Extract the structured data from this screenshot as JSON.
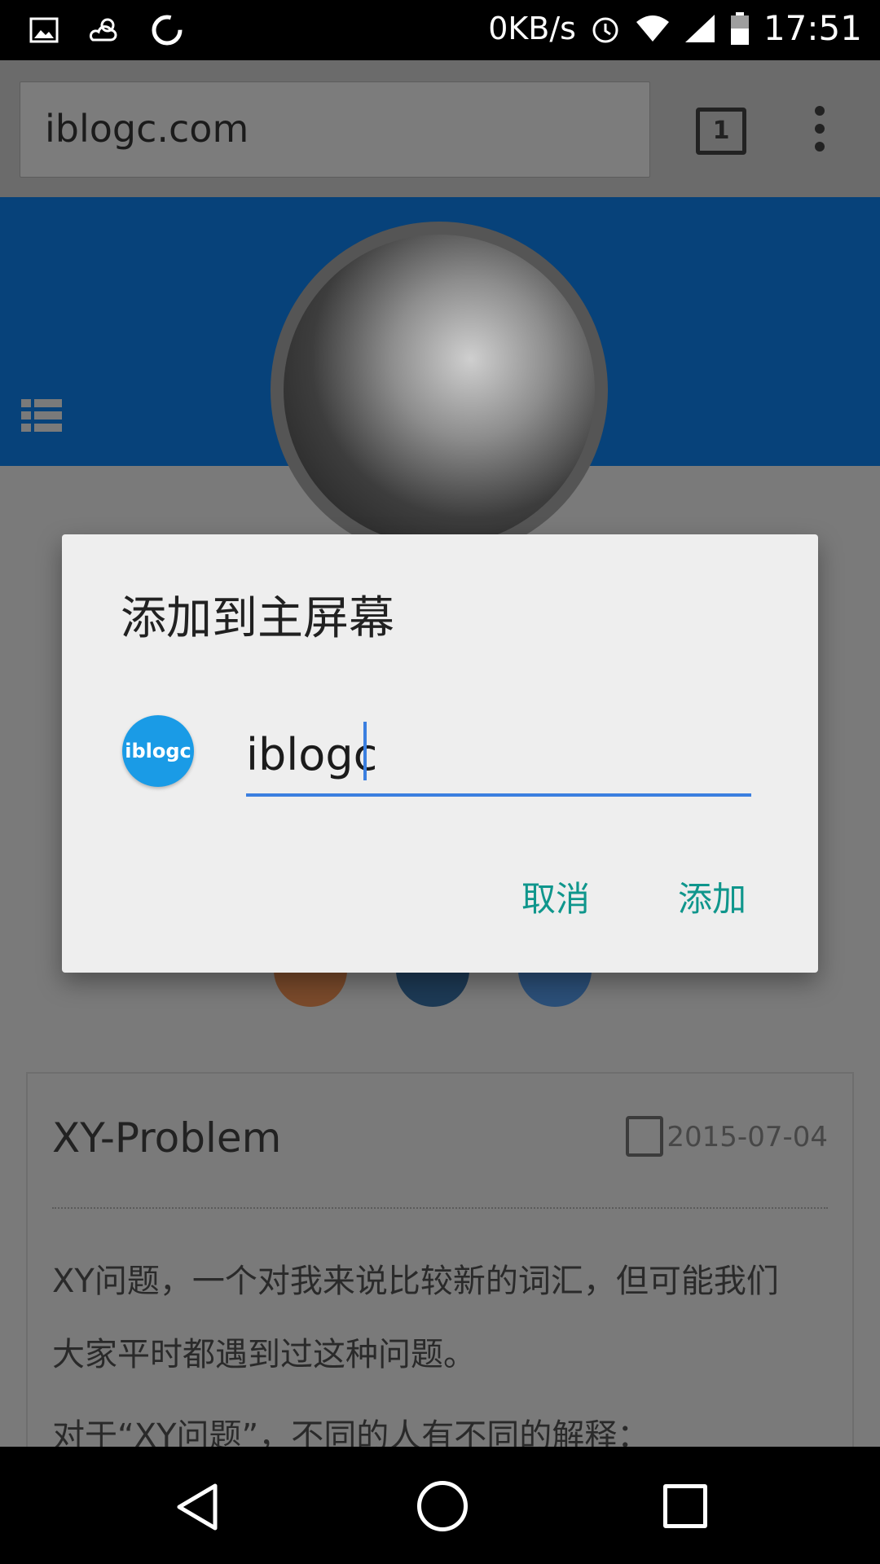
{
  "status_bar": {
    "network_speed": "0KB/s",
    "time": "17:51",
    "icons": [
      "image-icon",
      "weather-icon",
      "sync-icon",
      "alarm-icon",
      "wifi-icon",
      "signal-icon",
      "battery-icon"
    ]
  },
  "browser": {
    "url": "iblogc.com",
    "tab_count": "1",
    "menu_icon": "more-vert-icon"
  },
  "page": {
    "header_color": "#07427a",
    "post": {
      "title": "XY-Problem",
      "date": "2015-07-04",
      "paragraph_1_line_1": "XY问题，一个对我来说比较新的词汇，但可能我们",
      "paragraph_1_line_2": "大家平时都遇到过这种问题。",
      "paragraph_2": "对于“XY问题”，不同的人有不同的解释："
    },
    "social_colors": [
      "#7a4a2b",
      "#1d3a55",
      "#2b4f78"
    ]
  },
  "dialog": {
    "title": "添加到主屏幕",
    "site_icon_label": "iblogc",
    "input_value": "iblogc",
    "cancel_label": "取消",
    "add_label": "添加",
    "accent": "#0f968c",
    "input_underline": "#3b7fe0"
  },
  "nav_bar": {
    "icons": [
      "back-icon",
      "home-icon",
      "recents-icon"
    ]
  }
}
